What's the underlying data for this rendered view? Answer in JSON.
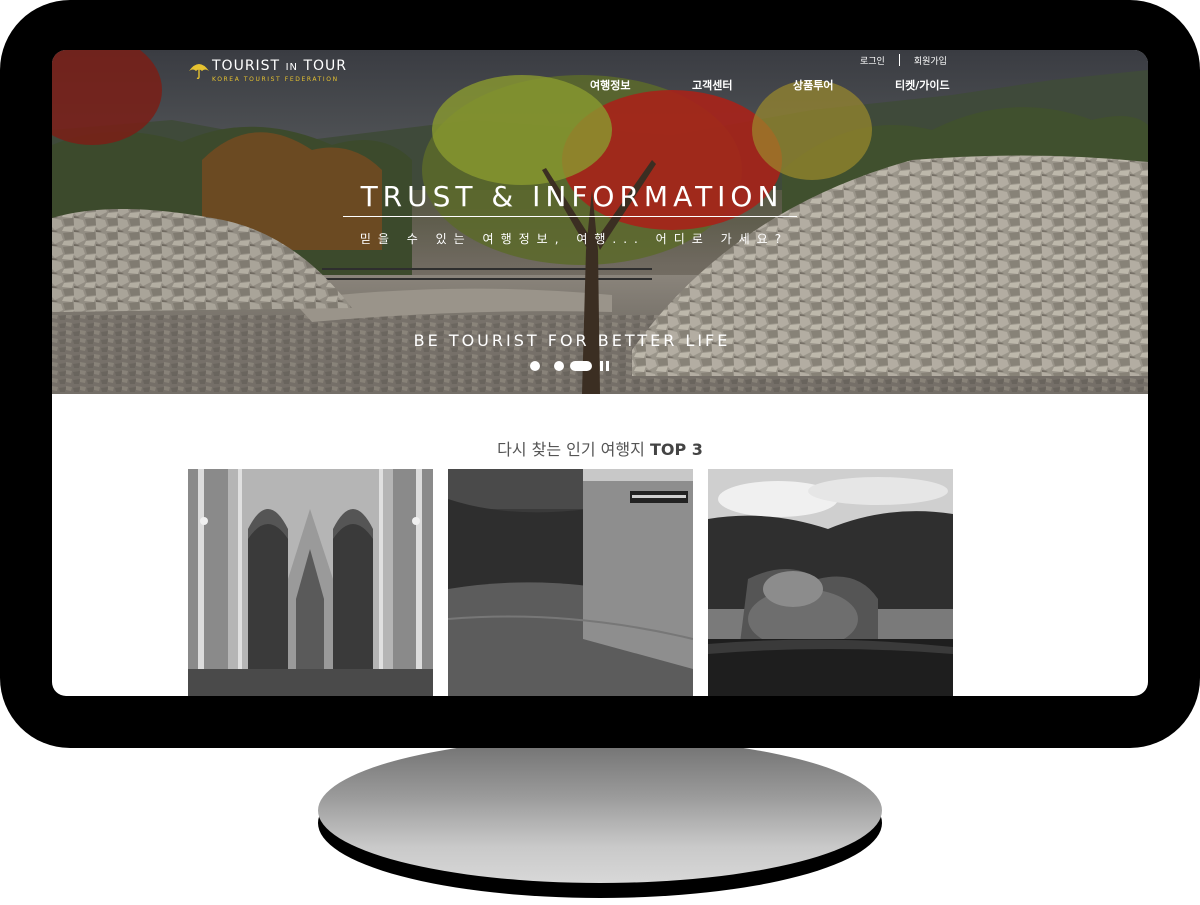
{
  "header": {
    "logo": {
      "title_main": "TOURIST",
      "title_small": "IN",
      "title_end": "TOUR",
      "subtitle": "KOREA TOURIST FEDERATION",
      "accent_color": "#e6c230"
    },
    "util_nav": [
      "로그인",
      "회원가입"
    ],
    "main_nav": [
      "여행정보",
      "고객센터",
      "상품투어",
      "티켓/가이드"
    ]
  },
  "hero": {
    "title": "TRUST & INFORMATION",
    "subtitle": "믿을 수 있는 여행정보, 여행... 어디로 가세요?",
    "tagline": "BE TOURIST FOR BETTER LIFE",
    "slides": 3,
    "active_slide": 3
  },
  "section": {
    "title_prefix": "다시 찾는 인기 여행지",
    "title_emphasis": "TOP 3"
  },
  "cards": [
    {
      "icon": "cathedral-photo"
    },
    {
      "icon": "water-reflection-photo"
    },
    {
      "icon": "japanese-garden-photo"
    }
  ]
}
